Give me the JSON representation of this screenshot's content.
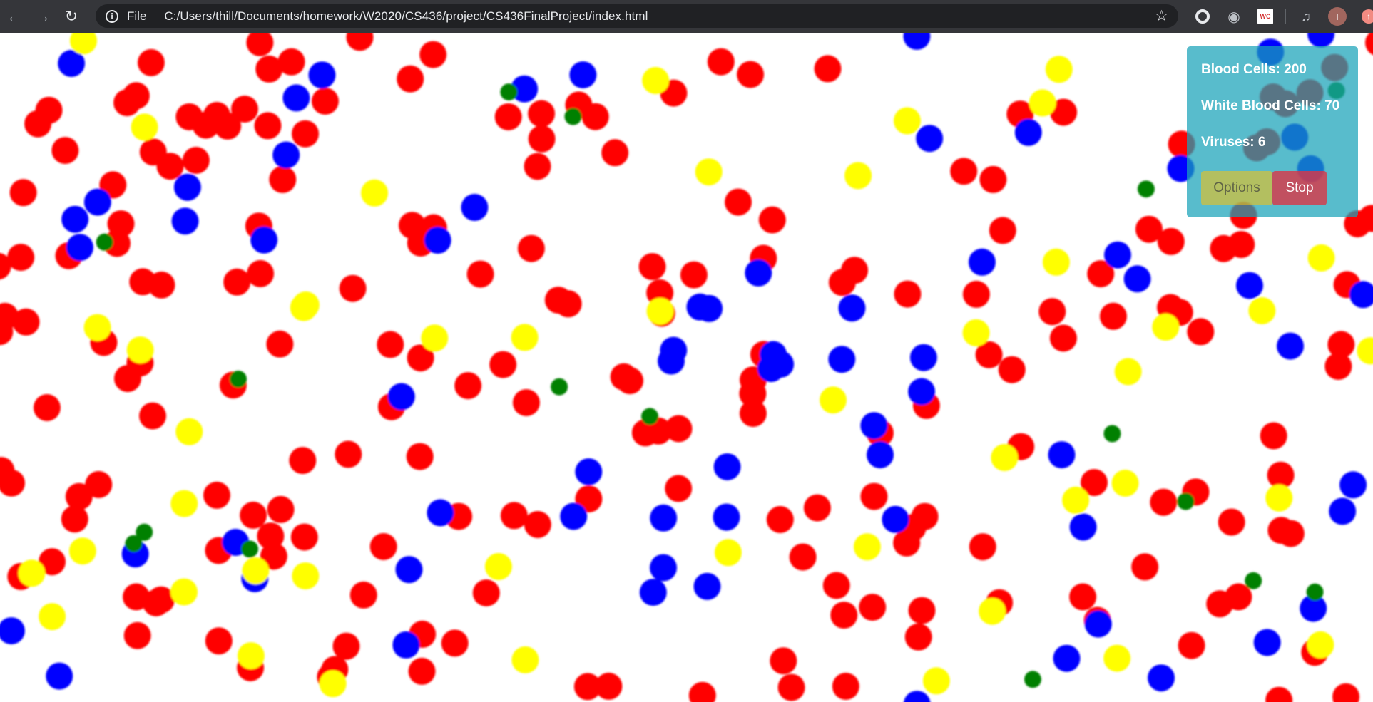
{
  "browser": {
    "file_label": "File",
    "url": "C:/Users/thill/Documents/homework/W2020/CS436/project/CS436FinalProject/index.html",
    "avatar_initial": "T",
    "extension_wc_label": "WC"
  },
  "panel": {
    "blood_cells_label": "Blood Cells:",
    "blood_cells_value": "200",
    "white_blood_cells_label": "White Blood Cells:",
    "white_blood_cells_value": "70",
    "viruses_label": "Viruses:",
    "viruses_value": "6",
    "options_label": "Options",
    "stop_label": "Stop"
  },
  "colors": {
    "red_cell": "#ff0000",
    "white_cell": "#0000ff",
    "virus": "#ffff00",
    "small_particle": "#008000",
    "panel_bg": "#17a2b8",
    "options_bg": "#ffc107",
    "stop_bg": "#dc3545"
  },
  "icons": {
    "back": "arrow-left-icon",
    "forward": "arrow-right-icon",
    "reload": "reload-icon",
    "info": "info-icon",
    "star": "star-icon"
  }
}
